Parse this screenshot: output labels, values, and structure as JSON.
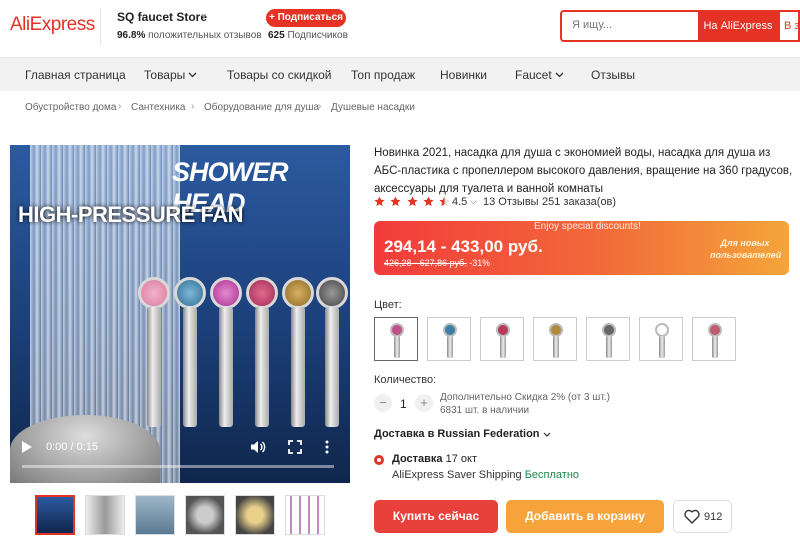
{
  "header": {
    "logo": "AliExpress",
    "store_name": "SQ faucet Store",
    "store_positive": "96.8%",
    "store_positive_label": "положительных отзывов",
    "subscribe_label": "+ Подписаться",
    "subscribers_count": "625",
    "subscribers_label": "Подписчиков",
    "search_placeholder": "Я ищу...",
    "search_button": "На AliExpress",
    "search_button_2": "В з"
  },
  "nav": {
    "items": [
      "Главная страница",
      "Товары",
      "Товары со скидкой",
      "Топ продаж",
      "Новинки",
      "Faucet",
      "Отзывы"
    ]
  },
  "breadcrumb": [
    "Обустройство дома",
    "Сантехника",
    "Оборудование для душа",
    "Душевые насадки"
  ],
  "video": {
    "title_1": "SHOWER HEAD",
    "title_2": "HIGH-PRESSURE FAN",
    "time": "0:00 / 0:15",
    "progress": 0
  },
  "product": {
    "title": "Новинка 2021, насадка для душа с экономией воды, насадка для душа из АБС-пластика с пропеллером высокого давления, вращение на 360 градусов, аксессуары для туалета и ванной комнаты",
    "rating": "4.5",
    "rating_value": 4.5,
    "reviews": "13 Отзывы",
    "orders": "251 заказа(ов)"
  },
  "price": {
    "promo": "Enjoy special discounts!",
    "current": "294,14 - 433,00 руб.",
    "old": "426,28 - 627,86 руб.",
    "discount": "-31%",
    "badge": "Для новых пользователей",
    "colors": {
      "start": "#f23b3b",
      "end": "#f4a53a"
    }
  },
  "options": {
    "color_label": "Цвет:",
    "swatches": [
      "#c0508a",
      "#3f7fa3",
      "#b83a5a",
      "#b08a3a",
      "#666666",
      "#ffffff",
      "#c05a70"
    ],
    "selected_index": 0
  },
  "quantity": {
    "label": "Количество:",
    "value": "1",
    "minus": "−",
    "plus": "+",
    "discount_text": "Дополнительно Скидка 2% (от 3 шт.)",
    "stock_text": "6831 шт. в наличии"
  },
  "shipping": {
    "ship_to": "Доставка в Russian Federation",
    "delivery_label": "Доставка",
    "delivery_date": "17 окт",
    "method": "AliExpress Saver Shipping",
    "free": "Бесплатно"
  },
  "actions": {
    "buy": "Купить сейчас",
    "cart": "Добавить в корзину",
    "wish_count": "912"
  },
  "colors": {
    "accent": "#e43225",
    "buy": "#e8413b",
    "cart": "#f5a33a"
  }
}
